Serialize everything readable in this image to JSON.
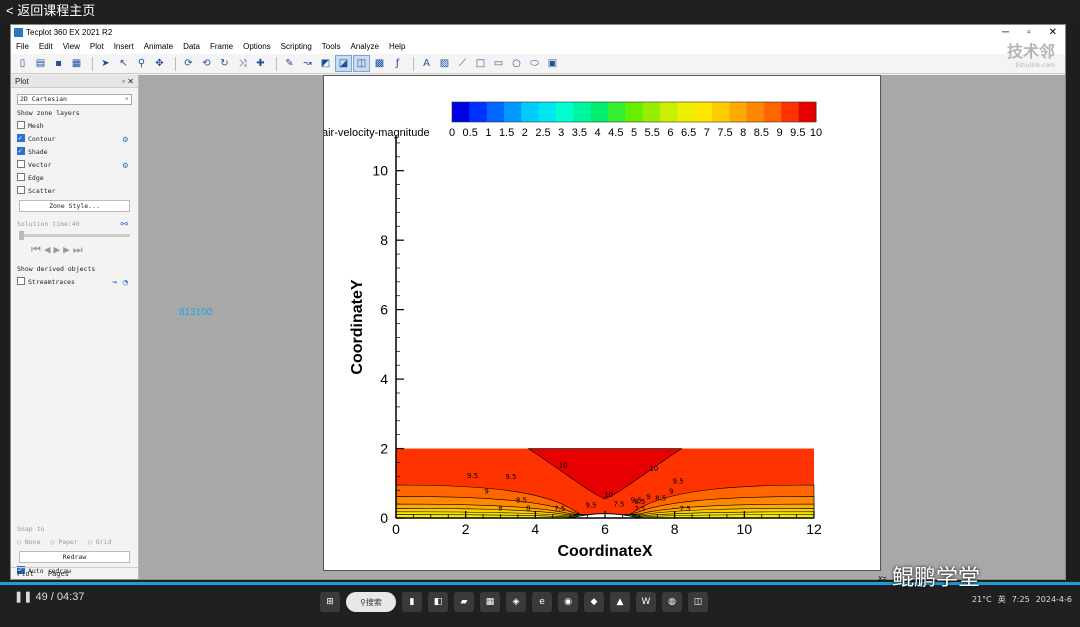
{
  "topbar": {
    "back_label": "< 返回课程主页"
  },
  "window": {
    "title": "Tecplot 360 EX 2021 R2"
  },
  "menu": [
    "File",
    "Edit",
    "View",
    "Plot",
    "Insert",
    "Animate",
    "Data",
    "Frame",
    "Options",
    "Scripting",
    "Tools",
    "Analyze",
    "Help"
  ],
  "watermark": {
    "name": "技术邻",
    "url": "Jishulink.com"
  },
  "panel": {
    "title": "Plot",
    "plot_type": "2D Cartesian",
    "show_layers_label": "Show zone layers",
    "layers": [
      {
        "label": "Mesh",
        "checked": false
      },
      {
        "label": "Contour",
        "checked": true
      },
      {
        "label": "Shade",
        "checked": true
      },
      {
        "label": "Vector",
        "checked": false
      },
      {
        "label": "Edge",
        "checked": false
      },
      {
        "label": "Scatter",
        "checked": false
      }
    ],
    "zone_style": "Zone Style...",
    "solution_time": "Solution time:40",
    "derived_label": "Show derived objects",
    "streamtraces": "Streamtraces",
    "snap_label": "Snap to",
    "snap_options": [
      "None",
      "Paper",
      "Grid"
    ],
    "redraw": "Redraw",
    "auto_redraw": "Auto redraw",
    "tabs": [
      "Plot",
      "Pages"
    ]
  },
  "overlay_time": "813100",
  "status": {
    "coords": "X=..."
  },
  "player": {
    "time": "49 / 04:37"
  },
  "taskbar": {
    "search": "搜索"
  },
  "tray": {
    "weather": "21°C",
    "lang": "英",
    "clock": "7:25",
    "date": "2024-4-6"
  },
  "wechat": "鲲鹏学堂",
  "chart_data": {
    "type": "contour",
    "legend_title": "air-velocity-magnitude",
    "levels": [
      "0",
      "0.5",
      "1",
      "1.5",
      "2",
      "2.5",
      "3",
      "3.5",
      "4",
      "4.5",
      "5",
      "5.5",
      "6",
      "6.5",
      "7",
      "7.5",
      "8",
      "8.5",
      "9",
      "9.5",
      "10"
    ],
    "level_colors": [
      "#0000e6",
      "#0033ff",
      "#0066ff",
      "#0099ff",
      "#00ccff",
      "#00e6f0",
      "#00ffd0",
      "#00f5a0",
      "#00ee70",
      "#33ee33",
      "#66ee00",
      "#99ee00",
      "#ccee00",
      "#eef000",
      "#ffe600",
      "#ffcc00",
      "#ffaa00",
      "#ff8800",
      "#ff6600",
      "#ff3300",
      "#e60000"
    ],
    "xlabel": "CoordinateX",
    "ylabel": "CoordinateY",
    "xlim": [
      0,
      12
    ],
    "ylim": [
      0,
      11
    ],
    "xticks": [
      0,
      2,
      4,
      6,
      8,
      10,
      12
    ],
    "yticks": [
      0,
      2,
      4,
      6,
      8,
      10
    ],
    "domain_height": 2,
    "contour_labels": [
      "9.5",
      "9.5",
      "10",
      "10",
      "9.5",
      "9",
      "9",
      "8.5",
      "8",
      "8",
      "7.5",
      "7.5",
      "7.5",
      "10",
      "9.5",
      "9.5",
      "8.5",
      "9",
      "8.5",
      "7.5"
    ]
  }
}
